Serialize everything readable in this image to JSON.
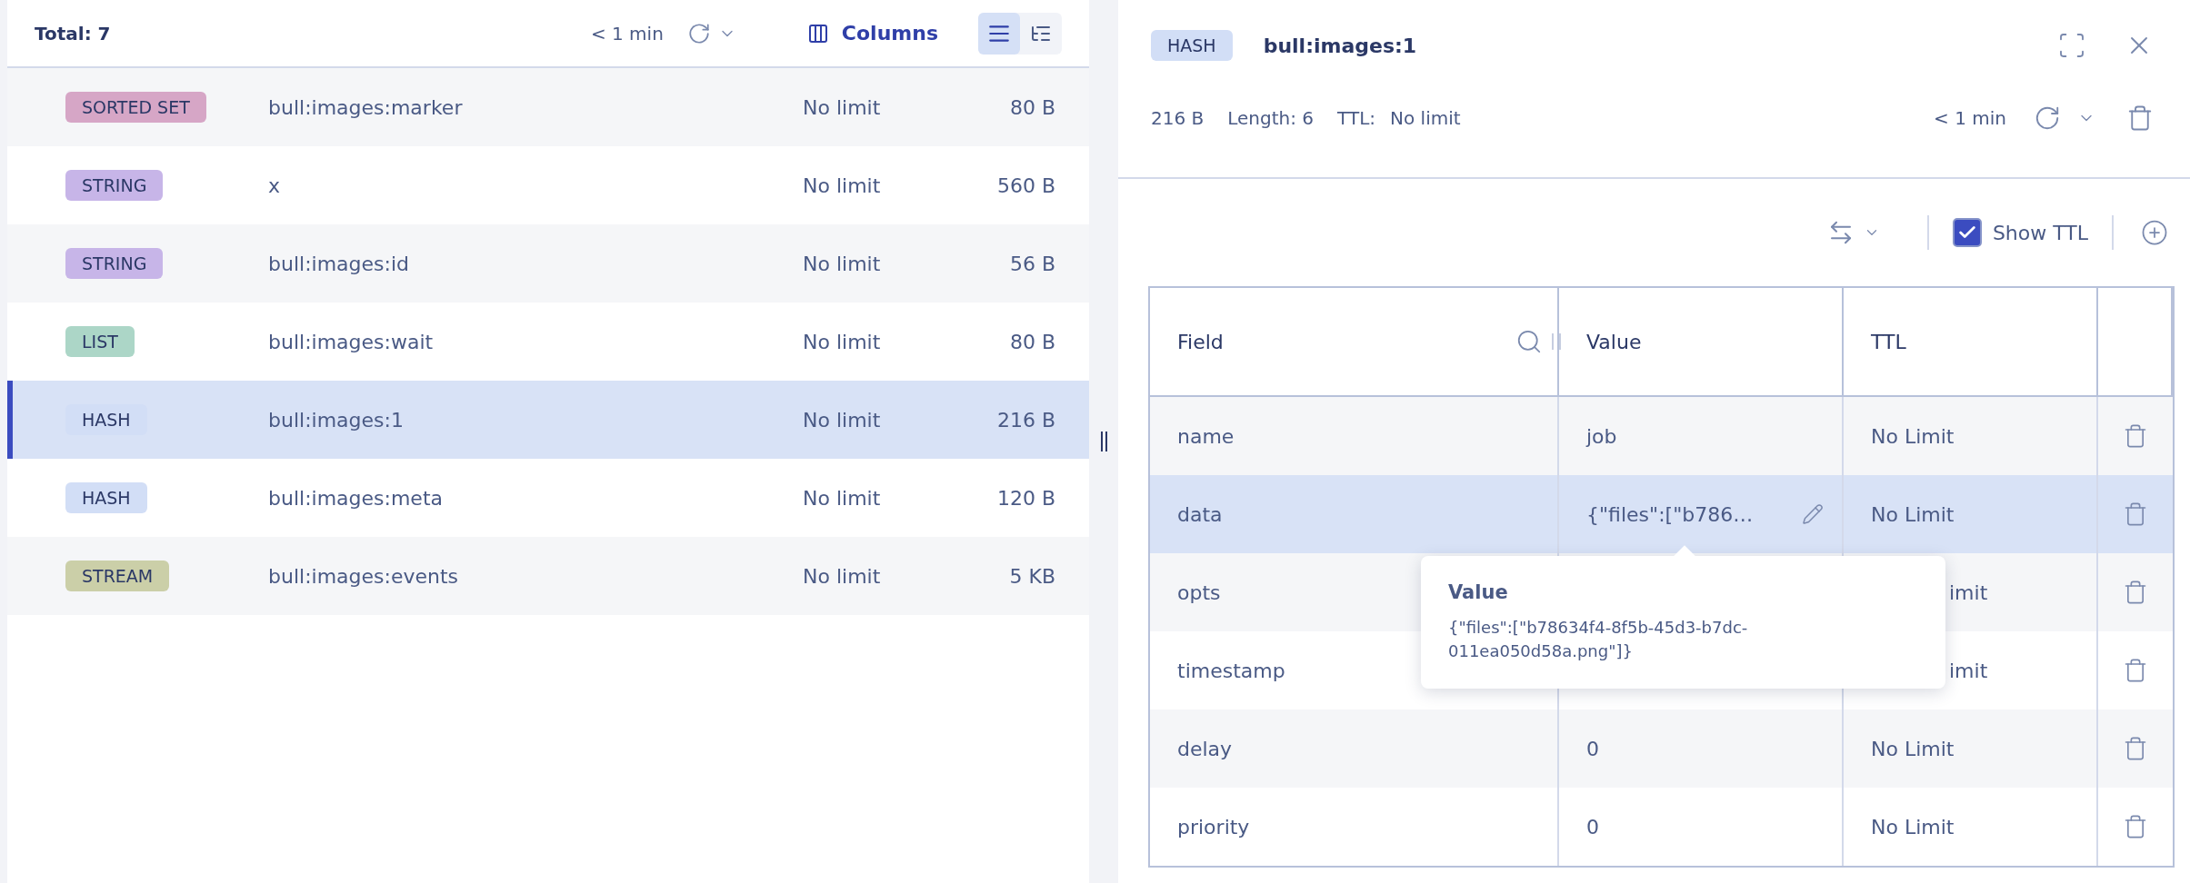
{
  "keys_header": {
    "total": "Total: 7",
    "refresh_age": "< 1 min",
    "columns_button": "Columns",
    "view_modes": [
      {
        "kind": "list",
        "selected": true
      },
      {
        "kind": "tree",
        "selected": false
      }
    ]
  },
  "keys": [
    {
      "type": "SORTED SET",
      "color": "#d6a6c6",
      "name": "bull:images:marker",
      "ttl": "No limit",
      "size": "80 B",
      "selected": false
    },
    {
      "type": "STRING",
      "color": "#c7b5e8",
      "name": "x",
      "ttl": "No limit",
      "size": "560 B",
      "selected": false
    },
    {
      "type": "STRING",
      "color": "#c7b5e8",
      "name": "bull:images:id",
      "ttl": "No limit",
      "size": "56 B",
      "selected": false
    },
    {
      "type": "LIST",
      "color": "#acd6c7",
      "name": "bull:images:wait",
      "ttl": "No limit",
      "size": "80 B",
      "selected": false
    },
    {
      "type": "HASH",
      "color": "#d2def6",
      "name": "bull:images:1",
      "ttl": "No limit",
      "size": "216 B",
      "selected": true
    },
    {
      "type": "HASH",
      "color": "#d2def6",
      "name": "bull:images:meta",
      "ttl": "No limit",
      "size": "120 B",
      "selected": false
    },
    {
      "type": "STREAM",
      "color": "#cbcfa8",
      "name": "bull:images:events",
      "ttl": "No limit",
      "size": "5 KB",
      "selected": false
    }
  ],
  "details": {
    "type": "HASH",
    "key": "bull:images:1",
    "size": "216 B",
    "length": "Length: 6",
    "ttl_label": "TTL:",
    "ttl": "No limit",
    "refresh_age": "< 1 min",
    "show_ttl": {
      "label": "Show TTL",
      "checked": true
    },
    "table": {
      "columns": [
        "Field",
        "Value",
        "TTL"
      ],
      "rows": [
        {
          "field": "name",
          "value": "job",
          "ttl": "No Limit",
          "selected": false,
          "covered": false
        },
        {
          "field": "data",
          "value": "{\"files\":[\"b786…",
          "ttl": "No Limit",
          "selected": true,
          "covered": false
        },
        {
          "field": "opts",
          "ttl": "imit",
          "selected": false,
          "covered": true
        },
        {
          "field": "timestamp",
          "ttl": "imit",
          "selected": false,
          "covered": true
        },
        {
          "field": "delay",
          "value": "0",
          "ttl": "No Limit",
          "selected": false,
          "covered": false
        },
        {
          "field": "priority",
          "value": "0",
          "ttl": "No Limit",
          "selected": false,
          "covered": false
        }
      ]
    },
    "tooltip": {
      "title": "Value",
      "text": "{\"files\":[\"b78634f4-8f5b-45d3-b7dc-011ea050d58a.png\"]}"
    }
  }
}
